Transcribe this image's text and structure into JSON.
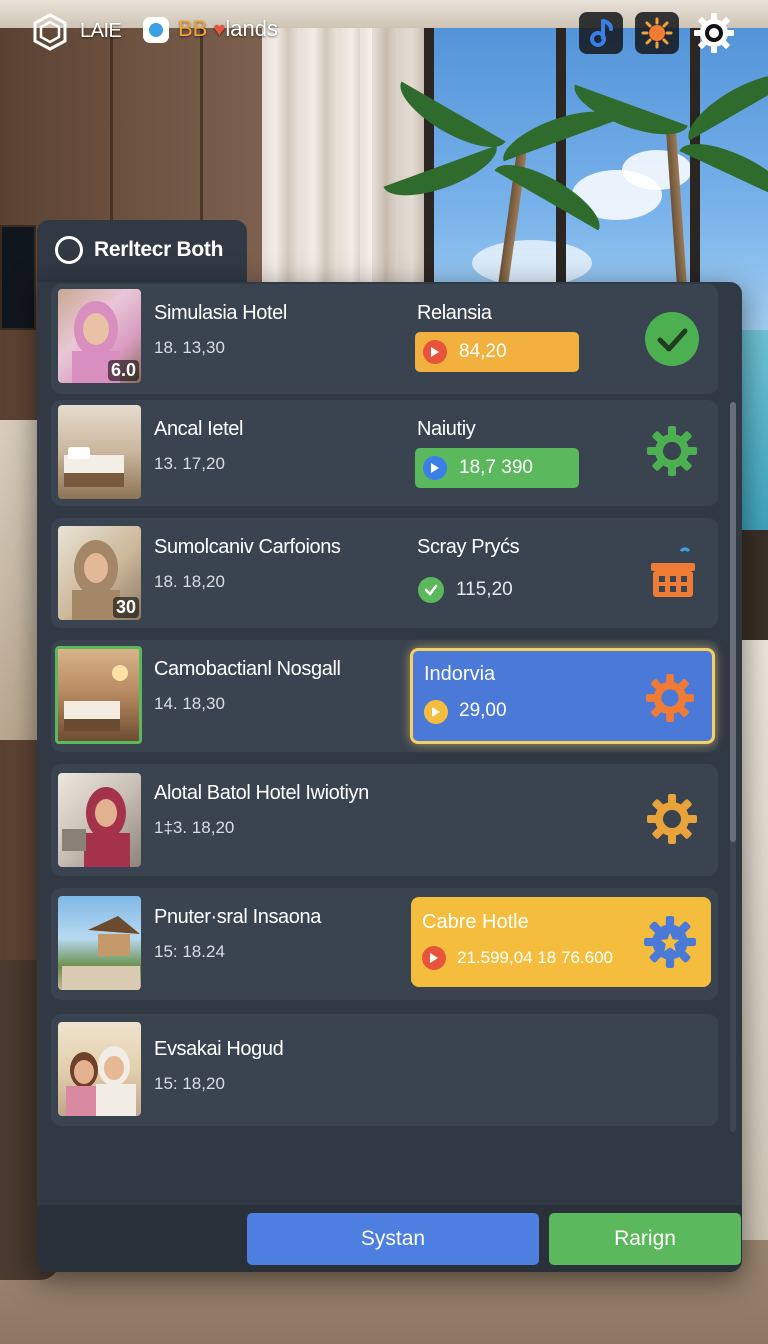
{
  "topbar": {
    "brand_name": "LAIE",
    "lands_prefix": "BB",
    "lands_text": "lands"
  },
  "panel": {
    "title": "Rerltecr Both"
  },
  "rows": [
    {
      "name": "Simulasia Hotel",
      "time": "18. 13,30",
      "thumb_overlay": "6.0",
      "label": "Relansia",
      "pill_value": "84,20",
      "pill_color": "#f2b13e",
      "action": "check-circle-icon"
    },
    {
      "name": "Ancal Ietel",
      "time": "13. 17,20",
      "label": "Naiutiy",
      "pill_value": "18,7 390",
      "pill_color": "#5cb85c",
      "action": "gear-icon"
    },
    {
      "name": "Sumolcaniv Carfoions",
      "time": "18. 18,20",
      "thumb_overlay": "30",
      "label": "Scray Pryćs",
      "pill_value": "115,20",
      "action": "basket-icon"
    },
    {
      "name": "Camobactianl Nosgall",
      "time": "14. 18,30",
      "label": "Indorvia",
      "pill_value": "29,00",
      "action": "gear-icon"
    },
    {
      "name": "Alotal Batol Hotel Iwiotiyn",
      "time": "1‡3. 18,20",
      "action": "gear-icon"
    },
    {
      "name": "Pnuter·sral Insaona",
      "time": "15: 18.24",
      "label": "Cabre Hotle",
      "pill_value": "21.599,04 18 76.600",
      "action": "gear-star-icon"
    },
    {
      "name": "Evsakai Hogud",
      "time": "15: 18,20"
    }
  ],
  "buttons": {
    "left": "Systan",
    "right": "Rarign"
  },
  "colors": {
    "panel": "#313945",
    "row": "#3a4350",
    "blue_button": "#4c7fe0",
    "green_button": "#5cb85c",
    "highlight_blue": "#4b79d8",
    "highlight_yellow": "#f5bd3e",
    "orange_icon": "#f07b34",
    "green_icon": "#4caf50"
  }
}
